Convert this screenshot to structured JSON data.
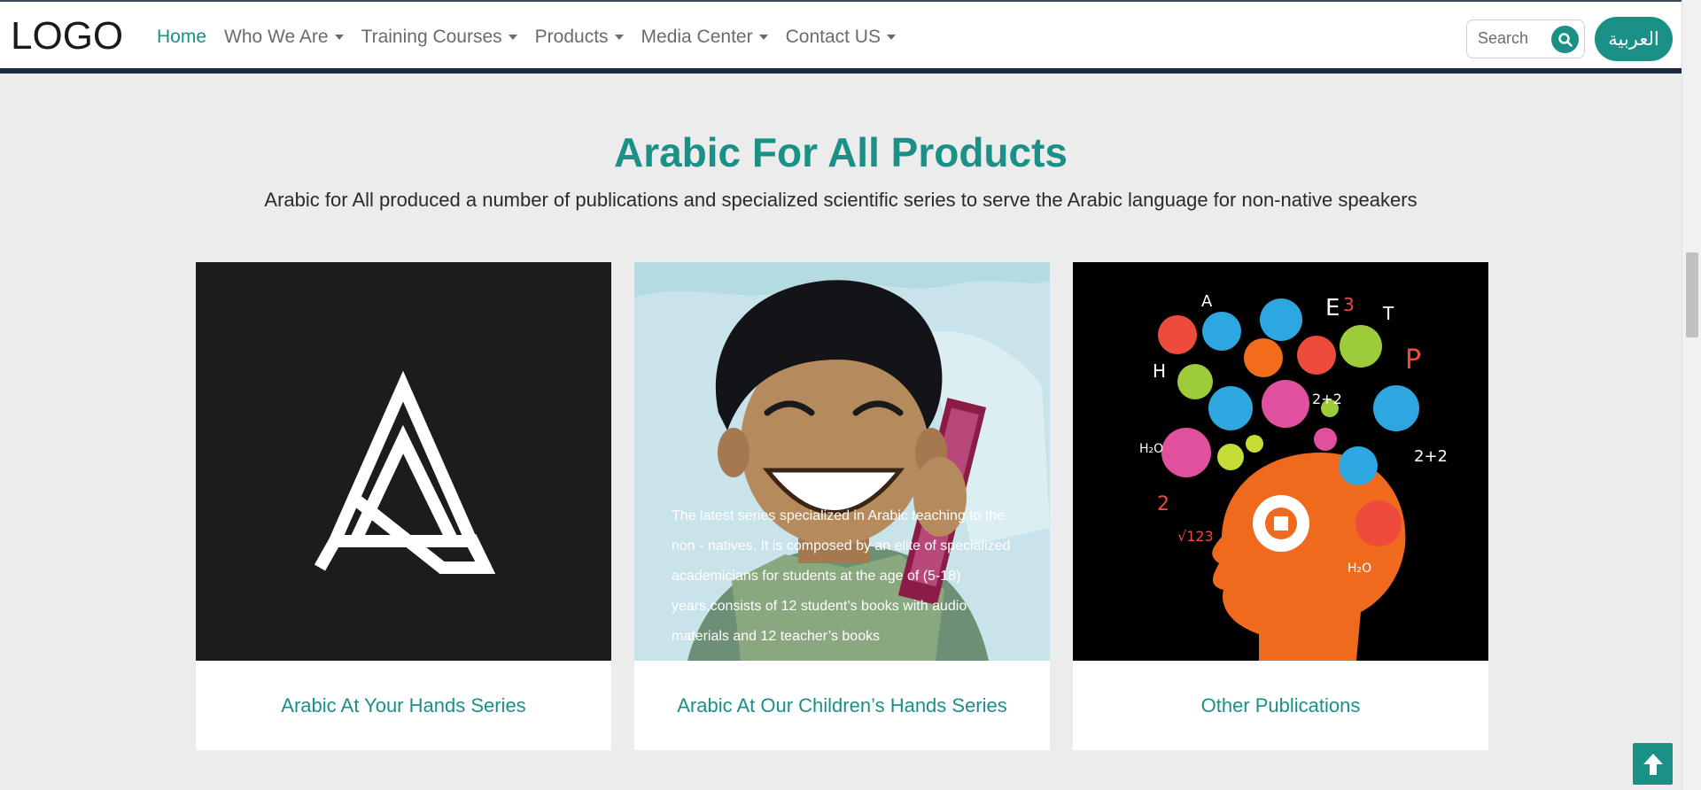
{
  "header": {
    "logo": "LOGO",
    "nav": [
      {
        "label": "Home",
        "active": true,
        "dropdown": false
      },
      {
        "label": "Who We Are",
        "active": false,
        "dropdown": true
      },
      {
        "label": "Training Courses",
        "active": false,
        "dropdown": true
      },
      {
        "label": "Products",
        "active": false,
        "dropdown": true
      },
      {
        "label": "Media Center",
        "active": false,
        "dropdown": true
      },
      {
        "label": "Contact US",
        "active": false,
        "dropdown": true
      }
    ],
    "search": {
      "placeholder": "Search",
      "icon": "search-icon"
    },
    "language_button": "العربية"
  },
  "main": {
    "title": "Arabic For All Products",
    "subtitle": "Arabic for All produced a number of publications and specialized scientific series to serve the Arabic language for non-native speakers",
    "cards": [
      {
        "caption": "Arabic At Your Hands Series",
        "image": "triangle-a-logo"
      },
      {
        "caption": "Arabic At Our Children’s Hands Series",
        "image": "smiling-boy-illustration",
        "overlay_text": "The latest series specialized in Arabic teaching to the non - natives. It is composed by an elite of specialized academicians for students at the age of (5-18) years,consists of 12 student’s books with audio materials and 12 teacher’s books"
      },
      {
        "caption": "Other Publications",
        "image": "head-with-icons-illustration"
      }
    ]
  },
  "colors": {
    "accent": "#1a9087",
    "header_border": "#1a2a40",
    "background": "#ececec"
  },
  "back_to_top_icon": "arrow-up-icon"
}
